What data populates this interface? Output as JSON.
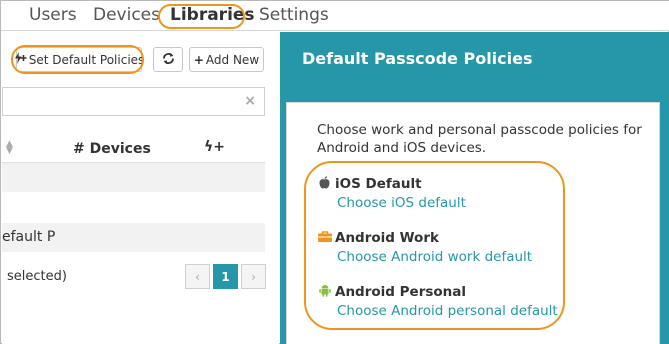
{
  "nav": {
    "tabs": [
      {
        "label": "Users"
      },
      {
        "label": "Devices"
      },
      {
        "label": "Libraries"
      },
      {
        "label": "Settings"
      }
    ],
    "active_tab": "Libraries"
  },
  "toolbar": {
    "set_default_label": "Set Default Policies",
    "set_default_icon": "flash-plus-icon",
    "refresh_icon": "refresh-icon",
    "add_new_label": "Add New",
    "add_new_icon": "+"
  },
  "search": {
    "value": "",
    "clear_icon": "×"
  },
  "table": {
    "columns": [
      {
        "label": "# Devices"
      },
      {
        "label": "ϟ+"
      }
    ],
    "rows": [
      {
        "text": ""
      },
      {
        "text": ""
      },
      {
        "text": "efault P"
      }
    ],
    "selection_text": "selected)"
  },
  "pagination": {
    "prev": "‹",
    "current": "1",
    "next": "›"
  },
  "panel": {
    "title": "Default Passcode Policies",
    "description": "Choose work and personal passcode policies for Android and iOS devices.",
    "policies": [
      {
        "title": "iOS Default",
        "link": "Choose iOS default",
        "icon": "apple-icon"
      },
      {
        "title": "Android Work",
        "link": "Choose Android work default",
        "icon": "briefcase-icon"
      },
      {
        "title": "Android Personal",
        "link": "Choose Android personal default",
        "icon": "android-icon"
      }
    ]
  },
  "colors": {
    "accent": "#2597a8",
    "highlight": "#f0951c"
  }
}
